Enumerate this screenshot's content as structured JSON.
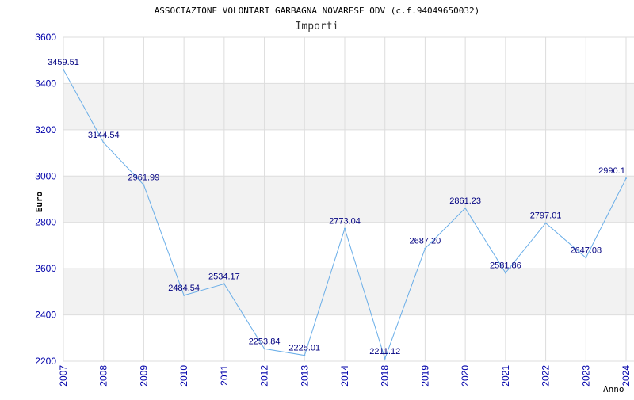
{
  "chart_data": {
    "type": "line",
    "title": "ASSOCIAZIONE VOLONTARI GARBAGNA NOVARESE ODV (c.f.94049650032)",
    "subtitle": "Importi",
    "xlabel": "Anno",
    "ylabel": "Euro",
    "ylim": [
      2200,
      3600
    ],
    "yticks": [
      "2200",
      "2400",
      "2600",
      "2800",
      "3000",
      "3200",
      "3400",
      "3600"
    ],
    "categories": [
      "2007",
      "2008",
      "2009",
      "2010",
      "2011",
      "2012",
      "2013",
      "2014",
      "2018",
      "2019",
      "2020",
      "2021",
      "2022",
      "2023",
      "2024"
    ],
    "values": [
      3459.51,
      3144.54,
      2961.99,
      2484.54,
      2534.17,
      2253.84,
      2225.01,
      2773.04,
      2211.12,
      2687.2,
      2861.23,
      2581.86,
      2797.01,
      2647.08,
      2990.1
    ],
    "labels": [
      "3459.51",
      "3144.54",
      "2961.99",
      "2484.54",
      "2534.17",
      "2253.84",
      "2225.01",
      "2773.04",
      "2211.12",
      "2687.20",
      "2861.23",
      "2581.86",
      "2797.01",
      "2647.08",
      "2990.1"
    ],
    "grid": true,
    "colors": {
      "line": "#6aaee8",
      "axis_text": "#0000aa",
      "label_text": "#000080",
      "band": "#f2f2f2",
      "grid": "#dddddd"
    }
  }
}
